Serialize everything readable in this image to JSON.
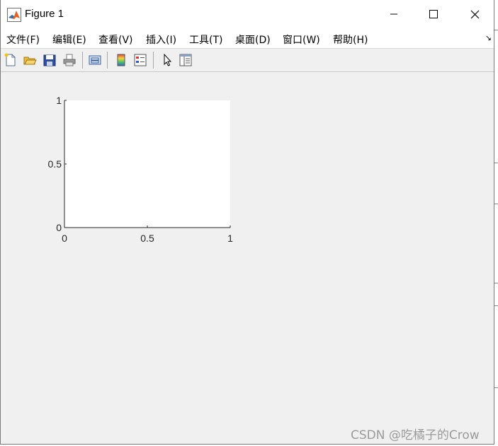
{
  "window": {
    "title": "Figure 1",
    "icon": "matlab-logo-icon"
  },
  "window_controls": {
    "minimize_glyph": "—",
    "maximize_glyph": "☐",
    "close_glyph": "✕"
  },
  "menu": [
    {
      "label": "文件(F)"
    },
    {
      "label": "编辑(E)"
    },
    {
      "label": "查看(V)"
    },
    {
      "label": "插入(I)"
    },
    {
      "label": "工具(T)"
    },
    {
      "label": "桌面(D)"
    },
    {
      "label": "窗口(W)"
    },
    {
      "label": "帮助(H)"
    }
  ],
  "menu_overflow": "↘",
  "toolbar": [
    {
      "icon": "new-figure-icon"
    },
    {
      "icon": "open-file-icon"
    },
    {
      "icon": "save-icon"
    },
    {
      "icon": "print-icon"
    },
    {
      "icon": "link-plot-icon"
    },
    {
      "icon": "insert-colorbar-icon"
    },
    {
      "icon": "insert-legend-icon"
    },
    {
      "icon": "edit-plot-pointer-icon"
    },
    {
      "icon": "open-property-inspector-icon"
    }
  ],
  "chart_data": {
    "type": "line",
    "series": [],
    "xlim": [
      0,
      1
    ],
    "ylim": [
      0,
      1
    ],
    "x_ticks": [
      "0",
      "0.5",
      "1"
    ],
    "y_ticks": [
      "0",
      "0.5",
      "1"
    ],
    "grid": false
  },
  "watermark": "CSDN @吃橘子的Crow",
  "colors": {
    "window_bg": "#f0f0f0",
    "plot_bg": "#ffffff",
    "axis": "#262626"
  }
}
